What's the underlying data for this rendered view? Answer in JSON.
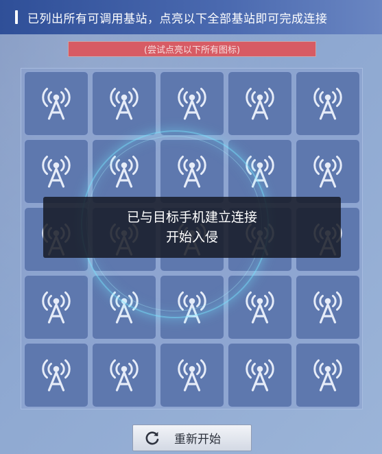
{
  "header": {
    "title": "已列出所有可调用基站，点亮以下全部基站即可完成连接"
  },
  "hint": {
    "text": "(尝试点亮以下所有图标)"
  },
  "grid": {
    "rows": 5,
    "columns": 5,
    "cell_icon": "antenna-tower-icon",
    "lit_count": 0,
    "total": 25
  },
  "toast": {
    "line1": "已与目标手机建立连接",
    "line2": "开始入侵"
  },
  "restart_button": {
    "icon": "refresh-icon",
    "label": "重新开始"
  },
  "colors": {
    "header": "#3a5aa3",
    "hint_bar": "#d75b64",
    "cell": "#5e78ae",
    "icon": "#e6ecf8",
    "scan_ring": "#78e6ff"
  }
}
